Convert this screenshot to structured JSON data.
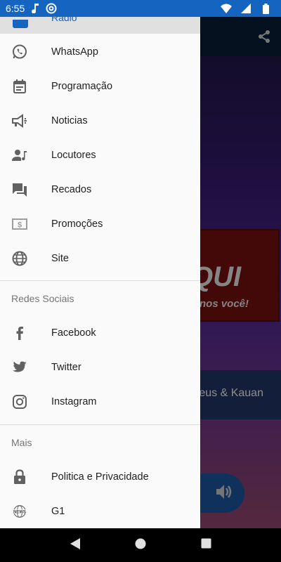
{
  "status_bar": {
    "time": "6:55"
  },
  "drawer": {
    "top_item": {
      "label": "Radio"
    },
    "menu_items": [
      {
        "label": "WhatsApp",
        "icon": "whatsapp-icon"
      },
      {
        "label": "Programação",
        "icon": "calendar-icon"
      },
      {
        "label": "Noticias",
        "icon": "megaphone-icon"
      },
      {
        "label": "Locutores",
        "icon": "person-music-icon"
      },
      {
        "label": "Recados",
        "icon": "chat-icon"
      },
      {
        "label": "Promoções",
        "icon": "money-icon"
      },
      {
        "label": "Site",
        "icon": "globe-icon"
      }
    ],
    "social_title": "Redes Sociais",
    "social_items": [
      {
        "label": "Facebook",
        "icon": "facebook-icon"
      },
      {
        "label": "Twitter",
        "icon": "twitter-icon"
      },
      {
        "label": "Instagram",
        "icon": "instagram-icon"
      }
    ],
    "more_title": "Mais",
    "more_items": [
      {
        "label": "Politica e Privacidade",
        "icon": "lock-icon"
      },
      {
        "label": "G1",
        "icon": "news-icon"
      }
    ]
  },
  "background": {
    "banner_big": "QUI",
    "banner_small": "nos você!",
    "now_playing": "theus & Kauan"
  },
  "colors": {
    "accent": "#1565c0",
    "drawer_bg": "#fafafa",
    "icon": "#616161"
  }
}
